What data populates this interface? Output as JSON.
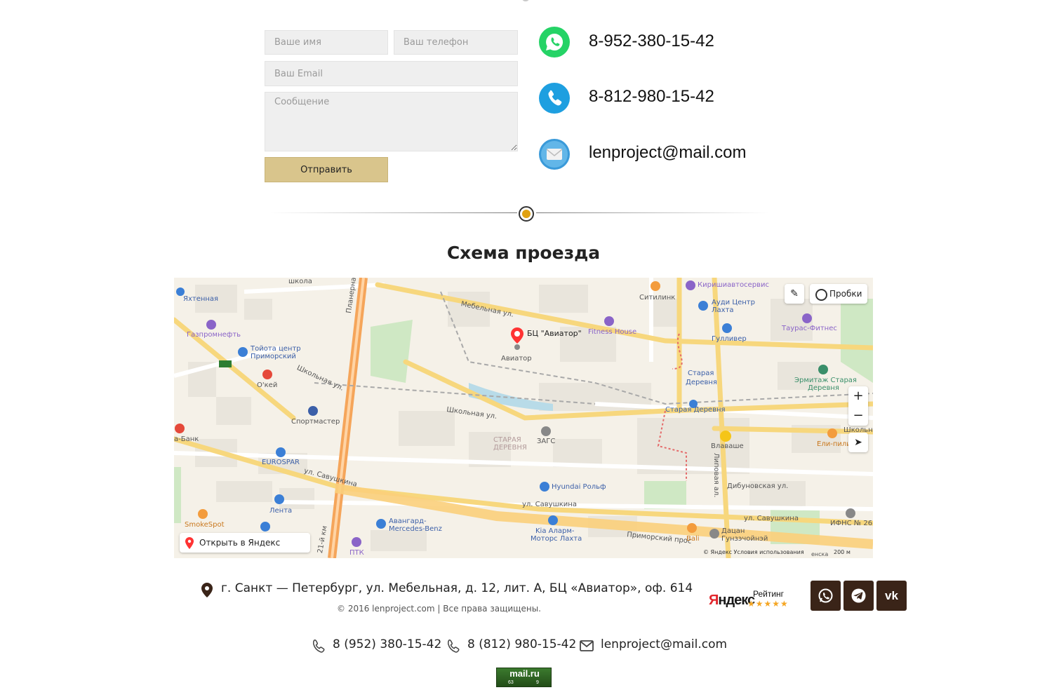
{
  "form": {
    "name_placeholder": "Ваше имя",
    "phone_placeholder": "Ваш телефон",
    "email_placeholder": "Ваш Email",
    "message_placeholder": "Сообщение",
    "submit_label": "Отправить"
  },
  "contacts": {
    "whatsapp": "8-952-380-15-42",
    "phone": "8-812-980-15-42",
    "email": "lenproject@mail.com",
    "whatsapp_icon": "whatsapp-icon",
    "phone_icon": "phone-icon",
    "mail_icon": "mail-envelope-icon"
  },
  "section_title": "Схема проезда",
  "map": {
    "traffic_label": "Пробки",
    "open_label": "Открыть в Яндекс Картах",
    "pin_label": "БЦ \"Авиатор\"",
    "footer": "© Яндекс   Условия использования",
    "scale": "200 м",
    "labels": {
      "shkola": "школа",
      "yakhtennaya": "Яхтенная",
      "gazpromneft": "Газпромнефть",
      "toyota": "Тойота центр",
      "primorsky_toyota": "Приморский",
      "okey": "О'кей",
      "shkolnaya1": "Школьная ул.",
      "shkolnaya2": "Школьная ул.",
      "sportmaster": "Спортмастер",
      "bank": "а-Банк",
      "eurospar": "EUROSPAR",
      "savushkina1": "ул. Савушкина",
      "savushkina2": "ул. Савушкина",
      "savushkina3": "ул. Савушкина",
      "lenta": "Лента",
      "smokespot": "SmokeSpot",
      "planernaya": "Планерная ул.",
      "km21": "21-й км",
      "ptk": "ПТК",
      "avangard": "Авангард-",
      "mercedes": "Mercedes-Benz",
      "mebelnaya": "Мебельная ул.",
      "aviator": "Авиатор",
      "fitness": "Fitness House",
      "sitilink": "Ситилинк",
      "kirishi": "Киришиавтосервис",
      "audi": "Ауди Центр",
      "lakhta": "Лахта",
      "gulliver": "Гулливер",
      "tauras": "Таурас-Фитнес",
      "staraya_derevnya_metro": "Старая",
      "derevnya_metro": "Деревня",
      "ermitazh": "Эрмитаж Старая",
      "ermitazh2": "Деревня",
      "staraya_derevnya_st": "Старая Деревня",
      "zags": "ЗАГС",
      "district": "СТАРАЯ",
      "district2": "ДЕРЕВНЯ",
      "vlavashe": "Влаваше",
      "eli_pili": "Ели-пили",
      "shkolna": "Школьна",
      "lipovaya": "Липовая ал.",
      "dibunovskaya": "Дибуновская ул.",
      "hyundai": "Hyundai Рольф",
      "kia": "Kia Аларм-",
      "kia2": "Моторс Лахта",
      "primorsky": "Приморский прос",
      "bali": "Bali",
      "datsan": "Дацан",
      "datsan2": "Гунзэчойнэй",
      "ifns": "ИФНС № 26",
      "enska": "енска"
    }
  },
  "footer": {
    "address": "г. Санкт — Петербург, ул. Мебельная, д. 12, лит. А, БЦ «Авиатор», оф. 614",
    "copyright": "© 2016 lenproject.com | Все права защищены.",
    "phone1": "8 (952) 380-15-42",
    "phone2": "8 (812) 980-15-42",
    "email": "lenproject@mail.com",
    "yandex_logo_first": "Я",
    "yandex_logo_rest": "ндекс",
    "yandex_rating": "Рейтинг",
    "yandex_stars": "★★★★★",
    "social": [
      "whatsapp-icon",
      "telegram-icon",
      "vk-icon"
    ],
    "mailru": {
      "title": "mail.ru",
      "n1": "63",
      "n2": "9"
    }
  },
  "colors": {
    "accent_gold": "#d9c58c",
    "divider_dot": "#e0a111",
    "social_bg": "#3a2418",
    "whatsapp": "#25d366",
    "phone": "#1e9fe0"
  }
}
